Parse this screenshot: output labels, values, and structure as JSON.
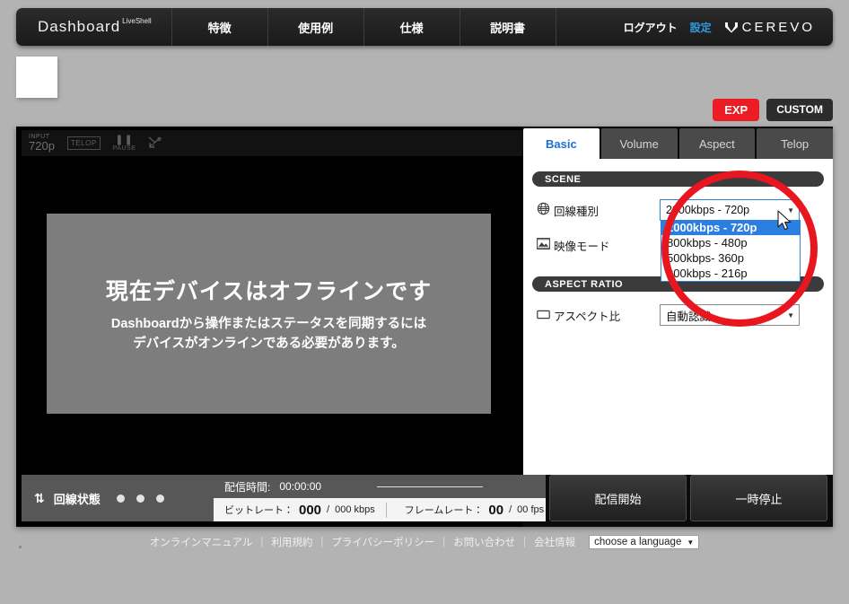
{
  "header": {
    "brand": "Dashboard",
    "brand_sup": "LiveShell",
    "nav": [
      {
        "label": "特徴"
      },
      {
        "label": "使用例"
      },
      {
        "label": "仕様"
      },
      {
        "label": "説明書"
      }
    ],
    "logout": "ログアウト",
    "settings": "設定",
    "logo_text": "CEREVO"
  },
  "mode_buttons": {
    "exp": "EXP",
    "custom": "CUSTOM",
    "exp_color": "#ec1c24",
    "custom_color": "#2c2c2c"
  },
  "video": {
    "status": {
      "input_label": "INPUT",
      "input_value": "720p",
      "telop": "TELOP",
      "pause_bars": "❚❚",
      "pause_label": "PAUSE",
      "cut_icon": "cut-icon"
    },
    "offline_title": "現在デバイスはオフラインです",
    "offline_line1": "Dashboardから操作またはステータスを同期するには",
    "offline_line2": "デバイスがオンラインである必要があります。"
  },
  "statusbar": {
    "connection_label": "回線状態",
    "dots": 3,
    "stream_time_label": "配信時間:",
    "stream_time_value": "00:00:00",
    "bitrate_label": "ビットレート：",
    "bitrate_value": "000",
    "bitrate_slash": "/",
    "bitrate_max": "000 kbps",
    "framerate_label": "フレームレート：",
    "framerate_value": "00",
    "framerate_slash": "/",
    "framerate_max": "00 fps",
    "start_button": "配信開始",
    "pause_button": "一時停止"
  },
  "panel": {
    "tabs": [
      {
        "label": "Basic",
        "active": true
      },
      {
        "label": "Volume",
        "active": false
      },
      {
        "label": "Aspect",
        "active": false
      },
      {
        "label": "Telop",
        "active": false
      }
    ],
    "scene_section": "SCENE",
    "aspect_section": "ASPECT RATIO",
    "rows": {
      "line_type_label": "回線種別",
      "line_type_value": "2000kbps - 720p",
      "video_mode_label": "映像モード",
      "aspect_label": "アスペクト比",
      "aspect_value": "自動認識"
    },
    "dropdown_options": [
      {
        "label": "2000kbps - 720p",
        "selected": true
      },
      {
        "label": "800kbps - 480p",
        "selected": false
      },
      {
        "label": "500kbps- 360p",
        "selected": false
      },
      {
        "label": "300kbps - 216p",
        "selected": false
      }
    ],
    "highlight_color": "#2a7fe0"
  },
  "annotation": {
    "shape": "circle",
    "color": "#e8161f"
  },
  "footer": {
    "links": [
      {
        "label": "オンラインマニュアル"
      },
      {
        "label": "利用規約"
      },
      {
        "label": "プライバシーポリシー"
      },
      {
        "label": "お問い合わせ"
      },
      {
        "label": "会社情報"
      }
    ],
    "separator": "|",
    "language_label": "choose a language",
    "caret": "▼"
  }
}
